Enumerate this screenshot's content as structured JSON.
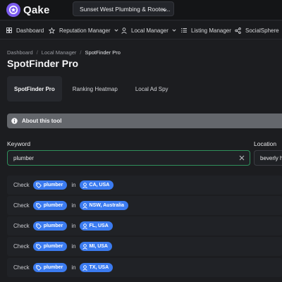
{
  "app": {
    "name": "Qake"
  },
  "org_selector": {
    "value": "Sunset West Plumbing & Rooter..."
  },
  "nav": [
    {
      "label": "Dashboard",
      "icon": "grid-icon"
    },
    {
      "label": "Reputation Manager",
      "icon": "star-icon",
      "dropdown": true
    },
    {
      "label": "Local Manager",
      "icon": "person-icon",
      "dropdown": true
    },
    {
      "label": "Listing Manager",
      "icon": "list-icon"
    },
    {
      "label": "SocialSphere",
      "icon": "share-icon"
    }
  ],
  "breadcrumb": [
    "Dashboard",
    "Local Manager",
    "SpotFinder Pro"
  ],
  "page_title": "SpotFinder Pro",
  "tabs": [
    {
      "label": "SpotFinder Pro",
      "active": true
    },
    {
      "label": "Ranking Heatmap",
      "active": false
    },
    {
      "label": "Local Ad Spy",
      "active": false
    }
  ],
  "about": {
    "label": "About this tool"
  },
  "keyword": {
    "label": "Keyword",
    "value": "plumber"
  },
  "location": {
    "label": "Location",
    "value": "beverly h"
  },
  "check_rows": [
    {
      "prefix": "Check",
      "keyword": "plumber",
      "joiner": "in",
      "location": "CA, USA"
    },
    {
      "prefix": "Check",
      "keyword": "plumber",
      "joiner": "in",
      "location": "NSW, Australia"
    },
    {
      "prefix": "Check",
      "keyword": "plumber",
      "joiner": "in",
      "location": "FL, USA"
    },
    {
      "prefix": "Check",
      "keyword": "plumber",
      "joiner": "in",
      "location": "MI, USA"
    },
    {
      "prefix": "Check",
      "keyword": "plumber",
      "joiner": "in",
      "location": "TX, USA"
    }
  ],
  "colors": {
    "brand": "#7c5cf0",
    "pill": "#3b7bf0",
    "input_focus": "#2f8f5b",
    "banner": "#64676c"
  }
}
